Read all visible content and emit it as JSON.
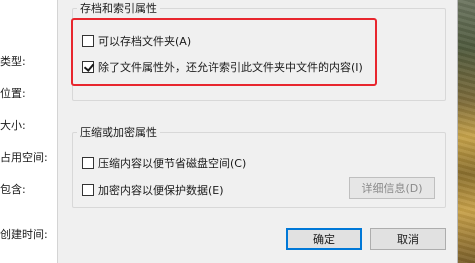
{
  "background_panel": {
    "labels": [
      "类型:",
      "位置:",
      "大小:",
      "占用空间:",
      "包含:",
      "创建时间:"
    ]
  },
  "archive_group": {
    "title": "存档和索引属性",
    "options": [
      {
        "label": "可以存档文件夹(A)",
        "checked": false
      },
      {
        "label": "除了文件属性外，还允许索引此文件夹中文件的内容(I)",
        "checked": true
      }
    ]
  },
  "compress_group": {
    "title": "压缩或加密属性",
    "options": [
      {
        "label": "压缩内容以便节省磁盘空间(C)",
        "checked": false
      },
      {
        "label": "加密内容以便保护数据(E)",
        "checked": false
      }
    ],
    "details_button": "详细信息(D)"
  },
  "footer": {
    "ok_button": "确定",
    "cancel_button": "取消"
  },
  "colors": {
    "highlight": "#e8262e",
    "default_button_border": "#0078d7"
  }
}
